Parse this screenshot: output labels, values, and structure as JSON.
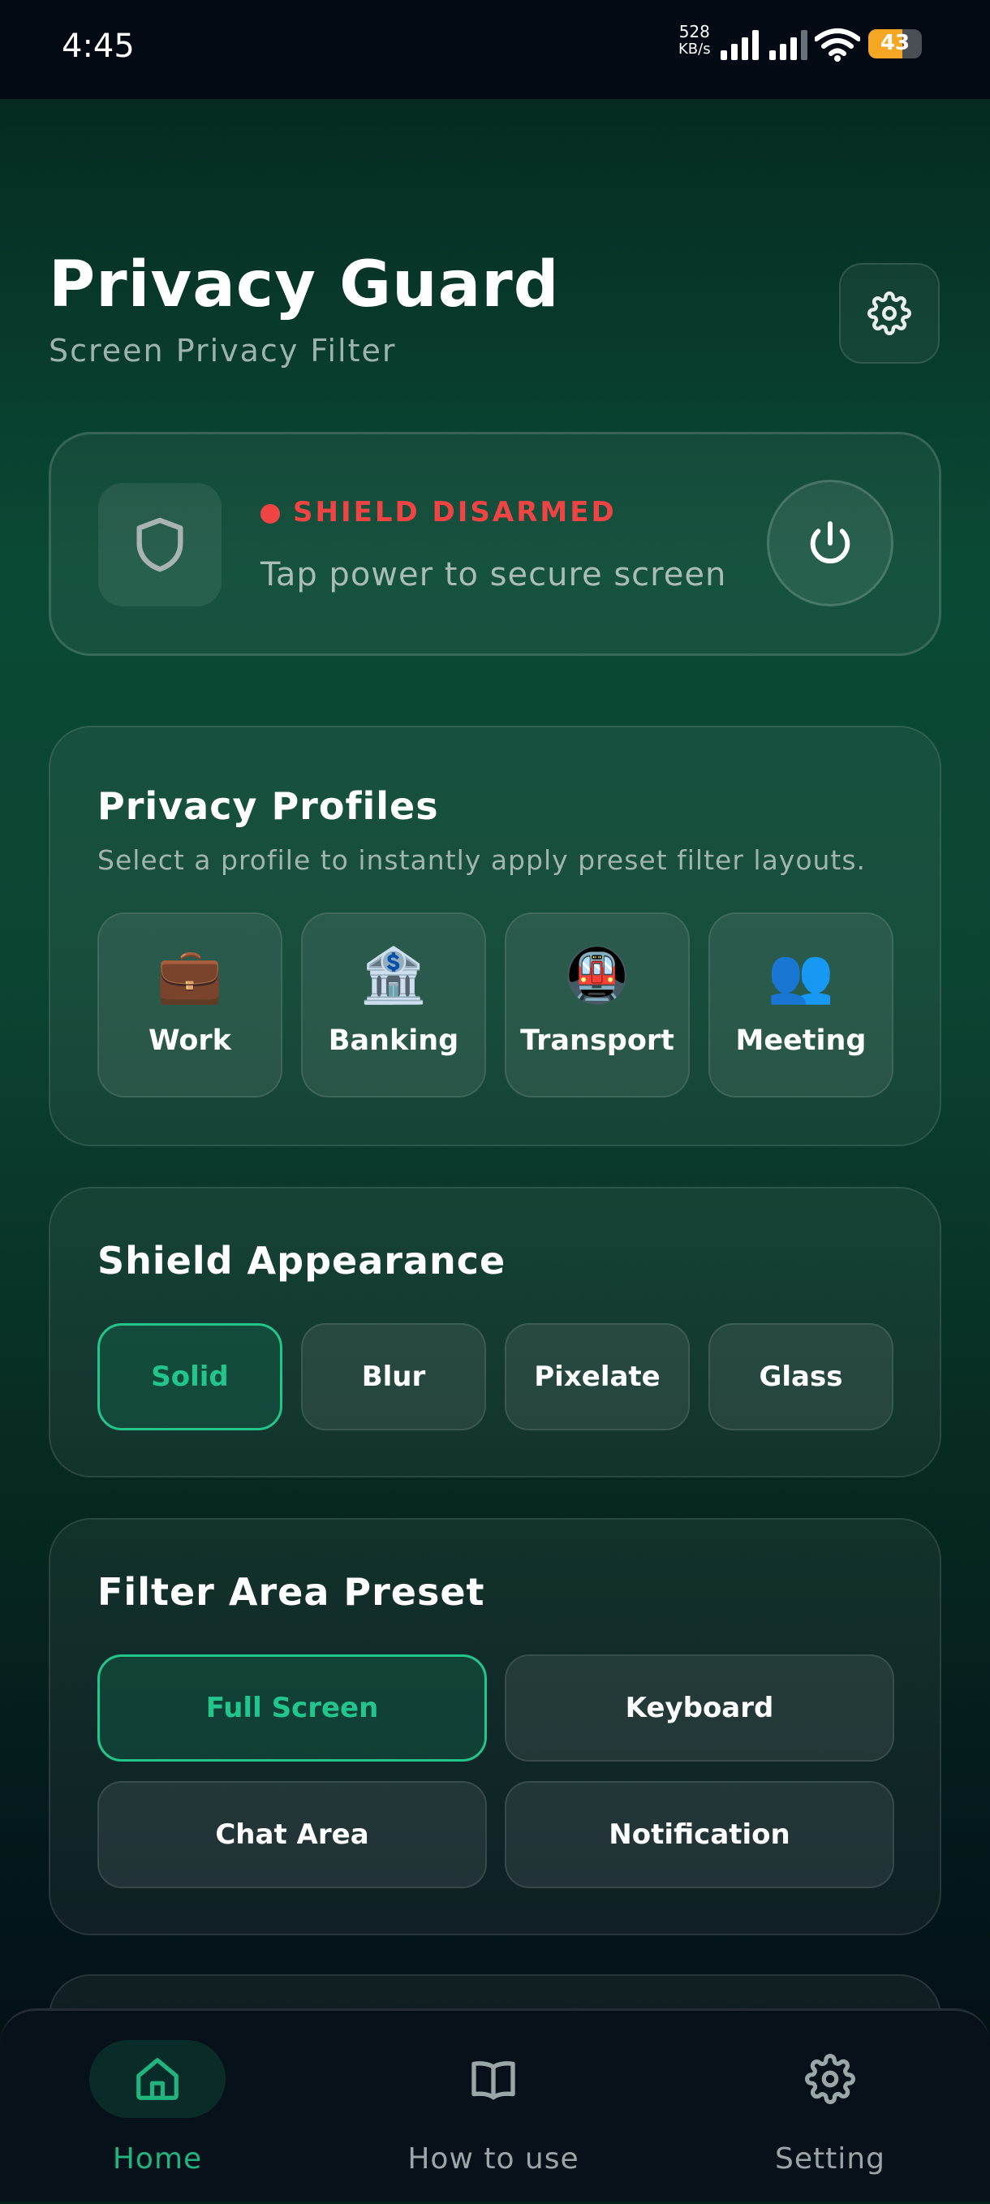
{
  "status_bar": {
    "time": "4:45",
    "speed_value": "528",
    "speed_unit": "KB/s",
    "battery": "43"
  },
  "header": {
    "title": "Privacy Guard",
    "subtitle": "Screen Privacy Filter",
    "settings_icon": "gear-icon"
  },
  "shield": {
    "status": "SHIELD DISARMED",
    "hint": "Tap power to secure screen",
    "status_color": "#ef4444"
  },
  "profiles": {
    "title": "Privacy Profiles",
    "description": "Select a profile to instantly apply preset filter layouts.",
    "items": [
      {
        "emoji": "💼",
        "label": "Work"
      },
      {
        "emoji": "🏦",
        "label": "Banking"
      },
      {
        "emoji": "🚇",
        "label": "Transport"
      },
      {
        "emoji": "👥",
        "label": "Meeting"
      }
    ]
  },
  "appearance": {
    "title": "Shield Appearance",
    "options": [
      "Solid",
      "Blur",
      "Pixelate",
      "Glass"
    ],
    "selected": "Solid"
  },
  "filter_area": {
    "title": "Filter Area Preset",
    "options": [
      "Full Screen",
      "Keyboard",
      "Chat Area",
      "Notification"
    ],
    "selected": "Full Screen"
  },
  "nav": {
    "items": [
      {
        "label": "Home",
        "icon": "home-icon",
        "active": true
      },
      {
        "label": "How to use",
        "icon": "book-icon",
        "active": false
      },
      {
        "label": "Setting",
        "icon": "gear-icon",
        "active": false
      }
    ]
  },
  "colors": {
    "accent": "#22c58b",
    "danger": "#ef4444",
    "background_top": "#04241d",
    "nav_background": "#071119"
  }
}
